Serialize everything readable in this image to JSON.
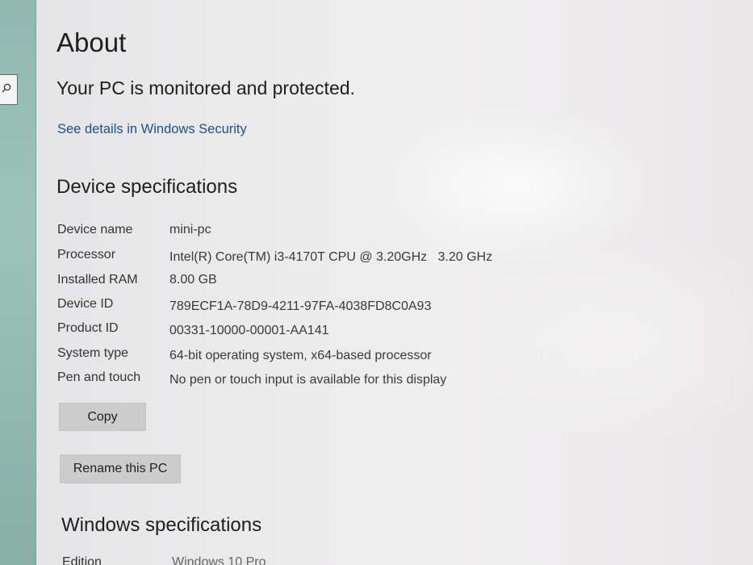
{
  "sidebar": {
    "search_icon": "search-icon"
  },
  "about": {
    "title": "About",
    "status": "Your PC is monitored and protected.",
    "security_link": "See details in Windows Security"
  },
  "device_specs": {
    "heading": "Device specifications",
    "rows": [
      {
        "label": "Device name",
        "value": "mini-pc"
      },
      {
        "label": "Processor",
        "value": "Intel(R) Core(TM) i3-4170T CPU @ 3.20GHz   3.20 GHz"
      },
      {
        "label": "Installed RAM",
        "value": "8.00 GB"
      },
      {
        "label": "Device ID",
        "value": "789ECF1A-78D9-4211-97FA-4038FD8C0A93"
      },
      {
        "label": "Product ID",
        "value": "00331-10000-00001-AA141"
      },
      {
        "label": "System type",
        "value": "64-bit operating system, x64-based processor"
      },
      {
        "label": "Pen and touch",
        "value": "No pen or touch input is available for this display"
      }
    ],
    "copy_label": "Copy",
    "rename_label": "Rename this PC"
  },
  "windows_specs": {
    "heading": "Windows specifications",
    "rows": [
      {
        "label": "Edition",
        "value": "Windows 10 Pro"
      }
    ]
  }
}
